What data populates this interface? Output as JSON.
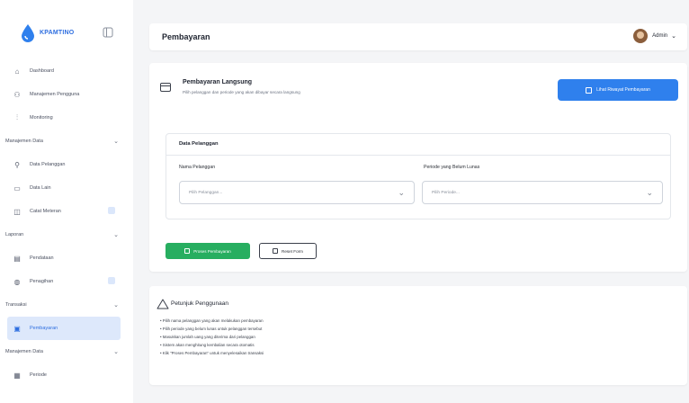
{
  "brand": {
    "name": "KPAMTINO"
  },
  "sidebar": {
    "items": [
      {
        "type": "item",
        "label": "Dashboard",
        "icon": "home-icon"
      },
      {
        "type": "item",
        "label": "Manajemen Pengguna",
        "icon": "users-icon"
      },
      {
        "type": "item",
        "label": "Monitoring",
        "icon": "chart-icon"
      },
      {
        "type": "section",
        "label": "Manajemen Data"
      },
      {
        "type": "item",
        "label": "Data Pelanggan",
        "icon": "user-icon"
      },
      {
        "type": "item",
        "label": "Data Lain",
        "icon": "folder-icon"
      },
      {
        "type": "item",
        "label": "Catat Meteran",
        "icon": "meter-icon",
        "badge": true
      },
      {
        "type": "section",
        "label": "Laporan"
      },
      {
        "type": "item",
        "label": "Pendataan",
        "icon": "document-icon"
      },
      {
        "type": "item",
        "label": "Penagihan",
        "icon": "receipt-icon",
        "badge": true
      },
      {
        "type": "section",
        "label": "Transaksi"
      },
      {
        "type": "item",
        "label": "Pembayaran",
        "icon": "wallet-icon",
        "active": true
      },
      {
        "type": "section",
        "label": "Manajemen Data"
      },
      {
        "type": "item",
        "label": "Periode",
        "icon": "calendar-icon"
      }
    ]
  },
  "header": {
    "title": "Pembayaran",
    "user": "Admin"
  },
  "payment": {
    "title": "Pembayaran Langsung",
    "subtitle": "Pilih pelanggan dan periode yang akan dibayar secara langsung",
    "history_button": "Lihat Riwayat Pembayaran"
  },
  "customer_data": {
    "title": "Data Pelanggan",
    "customer_label": "Nama Pelanggan",
    "customer_placeholder": "Pilih Pelanggan...",
    "period_label": "Periode yang Belum Lunas",
    "period_placeholder": "Pilih Periode..."
  },
  "actions": {
    "process": "Proses Pembayaran",
    "reset": "Reset Form"
  },
  "guide": {
    "title": "Petunjuk Penggunaan",
    "items": [
      "Pilih nama pelanggan yang akan melakukan pembayaran",
      "Pilih periode yang belum lunas untuk pelanggan tersebut",
      "Masukkan jumlah uang yang diterima dari pelanggan",
      "Sistem akan menghitung kembalian secara otomatis",
      "Klik \"Proses Pembayaran\" untuk menyelesaikan transaksi"
    ]
  },
  "colors": {
    "primary": "#2f80ed",
    "success": "#27ae60",
    "active_bg": "#dde8fb"
  }
}
